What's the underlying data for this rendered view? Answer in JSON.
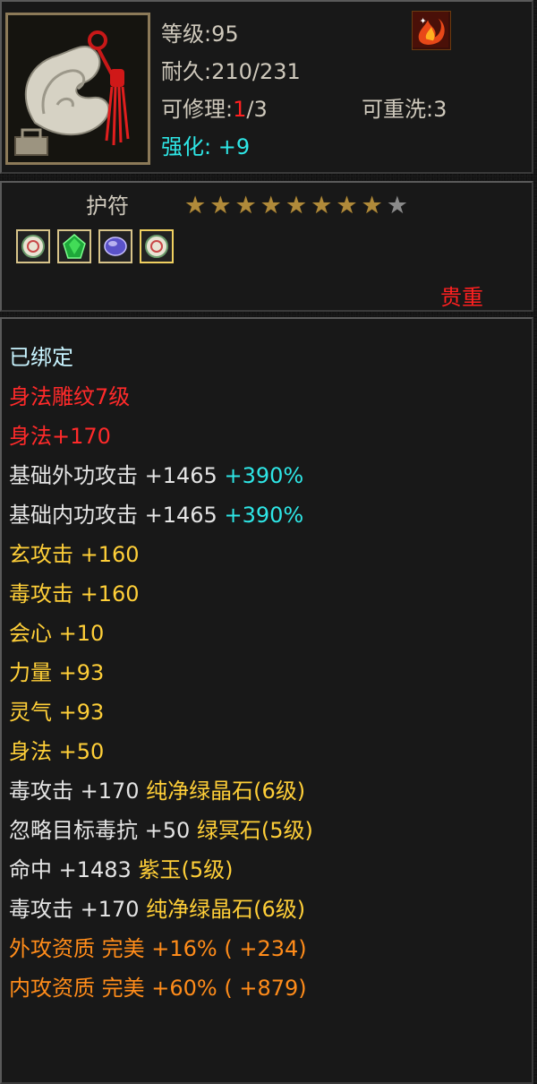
{
  "item": {
    "level_label": "等级:95",
    "durability_label": "耐久:210/231",
    "repair_prefix": "可修理:",
    "repair_used": "1",
    "repair_total": "/3",
    "rewash_label": "可重洗:3",
    "enhance_label": "强化:",
    "enhance_value": "+9",
    "type": "护符",
    "rarity": "贵重",
    "stars_filled": 8,
    "stars_total": 9,
    "gems": [
      "white-jade-gem-icon",
      "green-crystal-gem-icon",
      "purple-jade-gem-icon",
      "white-jade-gem-icon"
    ]
  },
  "stats": [
    {
      "text": "已绑定",
      "color": "bound"
    },
    {
      "text": "身法雕纹7级",
      "color": "red2"
    },
    {
      "text": "身法+170",
      "color": "red2"
    },
    {
      "text": "基础外功攻击  +1465",
      "extra": "+390%",
      "color": "white"
    },
    {
      "text": "基础内功攻击  +1465",
      "extra": "+390%",
      "color": "white"
    },
    {
      "text": "玄攻击  +160",
      "color": "yellow"
    },
    {
      "text": "毒攻击  +160",
      "color": "yellow"
    },
    {
      "text": "会心  +10",
      "color": "yellow"
    },
    {
      "text": "力量  +93",
      "color": "yellow"
    },
    {
      "text": "灵气  +93",
      "color": "yellow"
    },
    {
      "text": "身法  +50",
      "color": "yellow"
    },
    {
      "text": "毒攻击  +170",
      "extra": "纯净绿晶石(6级)",
      "color": "white"
    },
    {
      "text": "忽略目标毒抗  +50",
      "extra": "绿冥石(5级)",
      "color": "white"
    },
    {
      "text": "命中  +1483",
      "extra": "紫玉(5级)",
      "color": "white"
    },
    {
      "text": "毒攻击  +170",
      "extra": "纯净绿晶石(6级)",
      "color": "white"
    },
    {
      "text": "外攻资质   完美  +16%  ( +234)",
      "color": "orange"
    },
    {
      "text": "内攻资质   完美  +60%  ( +879)",
      "color": "orange"
    }
  ],
  "colors": {
    "gold_star": "#b08a3a",
    "grey_star": "#8a8a8a",
    "rarity": "#ff2020",
    "cyan": "#2ee6e6"
  }
}
